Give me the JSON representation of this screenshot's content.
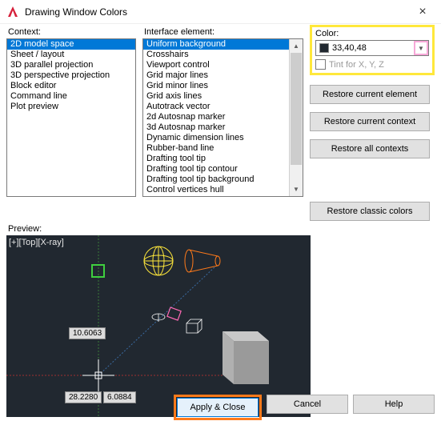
{
  "window": {
    "title": "Drawing Window Colors"
  },
  "labels": {
    "context": "Context:",
    "interface": "Interface element:",
    "color": "Color:",
    "tint": "Tint for X, Y, Z",
    "preview": "Preview:"
  },
  "context_items": [
    "2D model space",
    "Sheet / layout",
    "3D parallel projection",
    "3D perspective projection",
    "Block editor",
    "Command line",
    "Plot preview"
  ],
  "context_selected_index": 0,
  "interface_items": [
    "Uniform background",
    "Crosshairs",
    "Viewport control",
    "Grid major lines",
    "Grid minor lines",
    "Grid axis lines",
    "Autotrack vector",
    "2d Autosnap marker",
    "3d Autosnap marker",
    "Dynamic dimension lines",
    "Rubber-band line",
    "Drafting tool tip",
    "Drafting tool tip contour",
    "Drafting tool tip background",
    "Control vertices hull"
  ],
  "interface_selected_index": 0,
  "color_value": "33,40,48",
  "buttons": {
    "restore_element": "Restore current element",
    "restore_context": "Restore current context",
    "restore_all": "Restore all contexts",
    "restore_classic": "Restore classic colors",
    "apply": "Apply & Close",
    "cancel": "Cancel",
    "help": "Help"
  },
  "preview": {
    "view_label": "[+][Top][X-ray]",
    "coord1": "10.6063",
    "coord2": "28.2280",
    "coord3": "6.0884"
  }
}
